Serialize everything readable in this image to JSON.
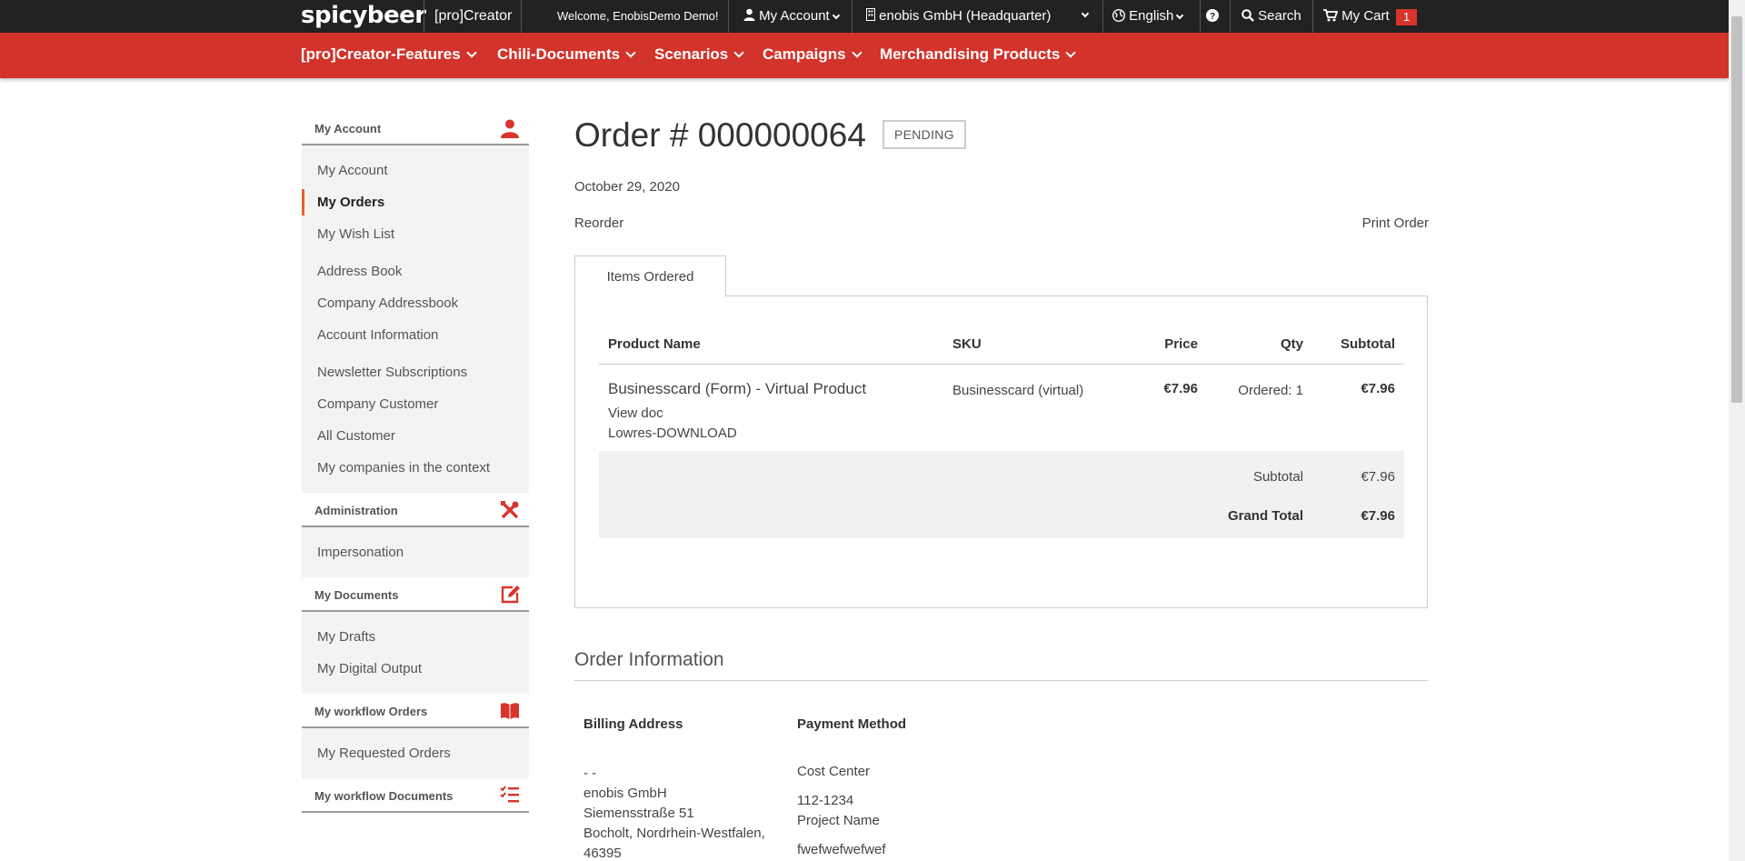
{
  "topbar": {
    "logo": "spicybeer",
    "brand_sub": "[pro]Creator",
    "welcome": "Welcome, EnobisDemo Demo!",
    "my_account": "My Account",
    "company": "enobis GmbH (Headquarter)",
    "language": "English",
    "search": "Search",
    "cart": "My Cart",
    "cart_count": "1"
  },
  "nav": {
    "items": [
      "[pro]Creator-Features",
      "Chili-Documents",
      "Scenarios",
      "Campaigns",
      "Merchandising Products"
    ]
  },
  "sidebar": {
    "sections": [
      {
        "title": "My Account",
        "icon": "user-icon",
        "links": [
          "My Account",
          "My Orders",
          "My Wish List",
          "Address Book",
          "Company Addressbook",
          "Account Information",
          "Newsletter Subscriptions",
          "Company Customer",
          "All Customer",
          "My companies in the context"
        ]
      },
      {
        "title": "Administration",
        "icon": "tools-icon",
        "links": [
          "Impersonation"
        ]
      },
      {
        "title": "My Documents",
        "icon": "edit-icon",
        "links": [
          "My Drafts",
          "My Digital Output"
        ]
      },
      {
        "title": "My workflow Orders",
        "icon": "book-icon",
        "links": [
          "My Requested Orders"
        ]
      },
      {
        "title": "My workflow Documents",
        "icon": "checklist-icon",
        "links": []
      }
    ],
    "active": "My Orders"
  },
  "order": {
    "title": "Order # 000000064",
    "status": "PENDING",
    "date": "October 29, 2020",
    "reorder": "Reorder",
    "print": "Print Order",
    "tab": "Items Ordered"
  },
  "items_table": {
    "headers": {
      "product": "Product Name",
      "sku": "SKU",
      "price": "Price",
      "qty": "Qty",
      "subtotal": "Subtotal"
    },
    "rows": [
      {
        "product": "Businesscard (Form) - Virtual Product",
        "option1": "View doc",
        "option2": "Lowres-DOWNLOAD",
        "sku": "Businesscard (virtual)",
        "price": "€7.96",
        "qty": "Ordered: 1",
        "subtotal": "€7.96"
      }
    ],
    "totals": {
      "subtotal_label": "Subtotal",
      "subtotal_value": "€7.96",
      "grand_label": "Grand Total",
      "grand_value": "€7.96"
    }
  },
  "order_info": {
    "heading": "Order Information",
    "billing_title": "Billing Address",
    "billing_lines": [
      "- -",
      "enobis GmbH",
      "Siemensstraße 51",
      "Bocholt, Nordrhein-Westfalen,",
      "46395"
    ],
    "payment_title": "Payment Method",
    "payment_method": "Cost Center",
    "cost_center": "112-1234",
    "project_label": "Project Name",
    "project_value": "fwefwefwefwef"
  },
  "colors": {
    "accent_red": "#d2332b",
    "topbar": "#222222",
    "active_marker": "#e8612c"
  }
}
